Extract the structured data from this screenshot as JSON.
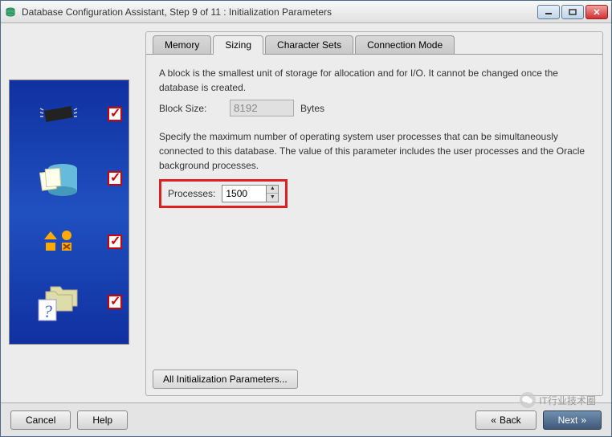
{
  "window": {
    "title": "Database Configuration Assistant, Step 9 of 11 : Initialization Parameters"
  },
  "tabs": {
    "memory": "Memory",
    "sizing": "Sizing",
    "character_sets": "Character Sets",
    "connection_mode": "Connection Mode"
  },
  "content": {
    "block_desc": "A block is the smallest unit of storage for allocation and for I/O. It cannot be changed once the database is created.",
    "block_size_label": "Block Size:",
    "block_size_value": "8192",
    "block_size_unit": "Bytes",
    "processes_desc": "Specify the maximum number of operating system user processes that can be simultaneously connected to this database. The value of this parameter includes the user processes and the Oracle background processes.",
    "processes_label": "Processes:",
    "processes_value": "1500"
  },
  "buttons": {
    "all_params": "All Initialization Parameters...",
    "cancel": "Cancel",
    "help": "Help",
    "back": "Back",
    "next": "Next"
  },
  "watermark": "IT行业技术圈"
}
